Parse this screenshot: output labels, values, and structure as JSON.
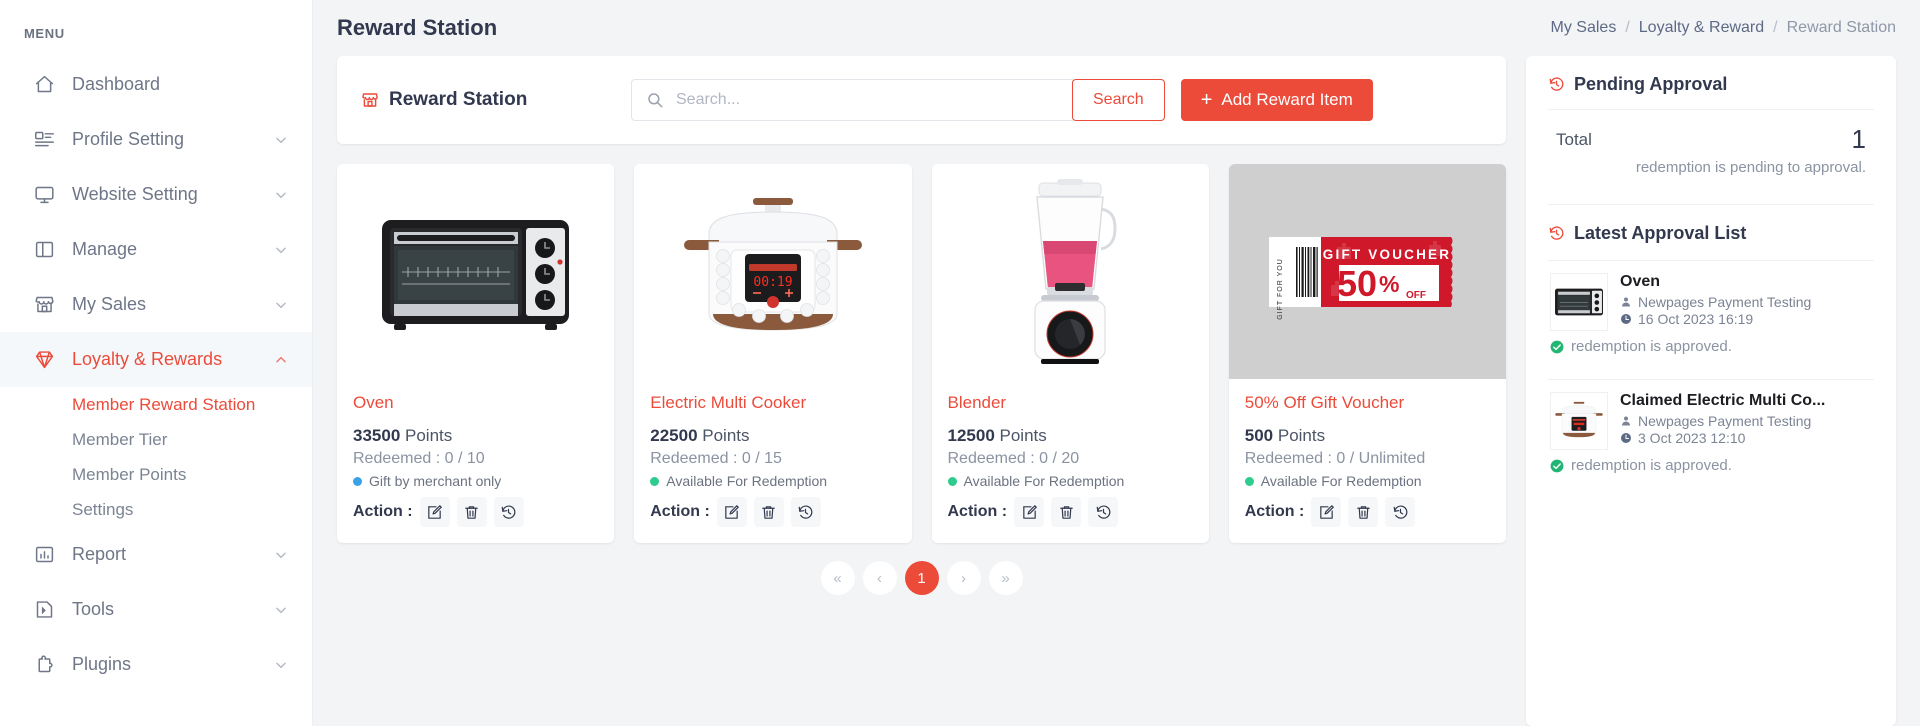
{
  "sidebar": {
    "menu_label": "MENU",
    "items": [
      {
        "label": "Dashboard",
        "icon": "home-icon",
        "expandable": false,
        "active": false
      },
      {
        "label": "Profile Setting",
        "icon": "profile-icon",
        "expandable": true,
        "active": false
      },
      {
        "label": "Website Setting",
        "icon": "monitor-icon",
        "expandable": true,
        "active": false
      },
      {
        "label": "Manage",
        "icon": "layout-icon",
        "expandable": true,
        "active": false
      },
      {
        "label": "My Sales",
        "icon": "store-icon",
        "expandable": true,
        "active": false
      },
      {
        "label": "Loyalty & Rewards",
        "icon": "diamond-icon",
        "expandable": true,
        "active": true
      },
      {
        "label": "Report",
        "icon": "chart-icon",
        "expandable": true,
        "active": false
      },
      {
        "label": "Tools",
        "icon": "tools-icon",
        "expandable": true,
        "active": false
      },
      {
        "label": "Plugins",
        "icon": "plugin-icon",
        "expandable": true,
        "active": false
      }
    ],
    "subitems": [
      {
        "label": "Member Reward Station",
        "active": true
      },
      {
        "label": "Member Tier",
        "active": false
      },
      {
        "label": "Member Points",
        "active": false
      },
      {
        "label": "Settings",
        "active": false
      }
    ]
  },
  "header": {
    "title": "Reward Station",
    "breadcrumb": [
      {
        "label": "My Sales",
        "current": false
      },
      {
        "label": "Loyalty & Reward",
        "current": false
      },
      {
        "label": "Reward Station",
        "current": true
      }
    ],
    "separator": "/"
  },
  "toolbar": {
    "title": "Reward Station",
    "title_icon": "store-icon",
    "search_placeholder": "Search...",
    "search_value": "",
    "search_icon": "magnifier-icon",
    "search_button": "Search",
    "add_button": "Add Reward Item",
    "add_icon": "plus-icon"
  },
  "cards": [
    {
      "name": "Oven",
      "image": "oven-image",
      "points": "33500",
      "points_unit": "Points",
      "redeemed_label": "Redeemed :",
      "redeemed": "0",
      "redeemed_sep": "/",
      "quota": "10",
      "status": "Gift by merchant only",
      "status_color": "#39a2e7",
      "action_label": "Action :",
      "actions": [
        "edit-icon",
        "delete-icon",
        "history-icon"
      ]
    },
    {
      "name": "Electric Multi Cooker",
      "image": "cooker-image",
      "points": "22500",
      "points_unit": "Points",
      "redeemed_label": "Redeemed :",
      "redeemed": "0",
      "redeemed_sep": "/",
      "quota": "15",
      "status": "Available For Redemption",
      "status_color": "#2ecc8f",
      "action_label": "Action :",
      "actions": [
        "edit-icon",
        "delete-icon",
        "history-icon"
      ]
    },
    {
      "name": "Blender",
      "image": "blender-image",
      "points": "12500",
      "points_unit": "Points",
      "redeemed_label": "Redeemed :",
      "redeemed": "0",
      "redeemed_sep": "/",
      "quota": "20",
      "status": "Available For Redemption",
      "status_color": "#2ecc8f",
      "action_label": "Action :",
      "actions": [
        "edit-icon",
        "delete-icon",
        "history-icon"
      ]
    },
    {
      "name": "50% Off Gift Voucher",
      "image": "voucher-image",
      "points": "500",
      "points_unit": "Points",
      "redeemed_label": "Redeemed :",
      "redeemed": "0",
      "redeemed_sep": "/",
      "quota": "Unlimited",
      "status": "Available For Redemption",
      "status_color": "#2ecc8f",
      "action_label": "Action :",
      "actions": [
        "edit-icon",
        "delete-icon",
        "history-icon"
      ]
    }
  ],
  "voucher_art": {
    "stub_text": "GIFT FOR YOU",
    "title": "GIFT VOUCHER",
    "amount": "50",
    "percent": "%",
    "off": "OFF"
  },
  "cooker_art": {
    "display": "00:19"
  },
  "pagination": {
    "first": "«",
    "prev": "‹",
    "pages": [
      {
        "label": "1",
        "active": true
      }
    ],
    "next": "›",
    "last": "»"
  },
  "pending_approval": {
    "heading": "Pending Approval",
    "heading_icon": "history-icon",
    "total_label": "Total",
    "total_value": "1",
    "subtext": "redemption is pending to approval."
  },
  "latest_approval": {
    "heading": "Latest Approval List",
    "heading_icon": "history-icon",
    "items": [
      {
        "name": "Oven",
        "image": "oven-image",
        "user": "Newpages Payment Testing",
        "user_icon": "user-icon",
        "time": "16 Oct 2023 16:19",
        "time_icon": "clock-icon",
        "status": "redemption is approved.",
        "status_icon": "check-circle-icon"
      },
      {
        "name": "Claimed Electric Multi Co...",
        "image": "cooker-image",
        "user": "Newpages Payment Testing",
        "user_icon": "user-icon",
        "time": "3 Oct 2023 12:10",
        "time_icon": "clock-icon",
        "status": "redemption is approved.",
        "status_icon": "check-circle-icon"
      }
    ]
  },
  "colors": {
    "accent": "#ec4b3a",
    "page_bg": "#f3f4f6",
    "text_dark": "#32394e",
    "text_muted": "#7b8494",
    "status_green": "#2ecc8f",
    "status_blue": "#39a2e7"
  }
}
